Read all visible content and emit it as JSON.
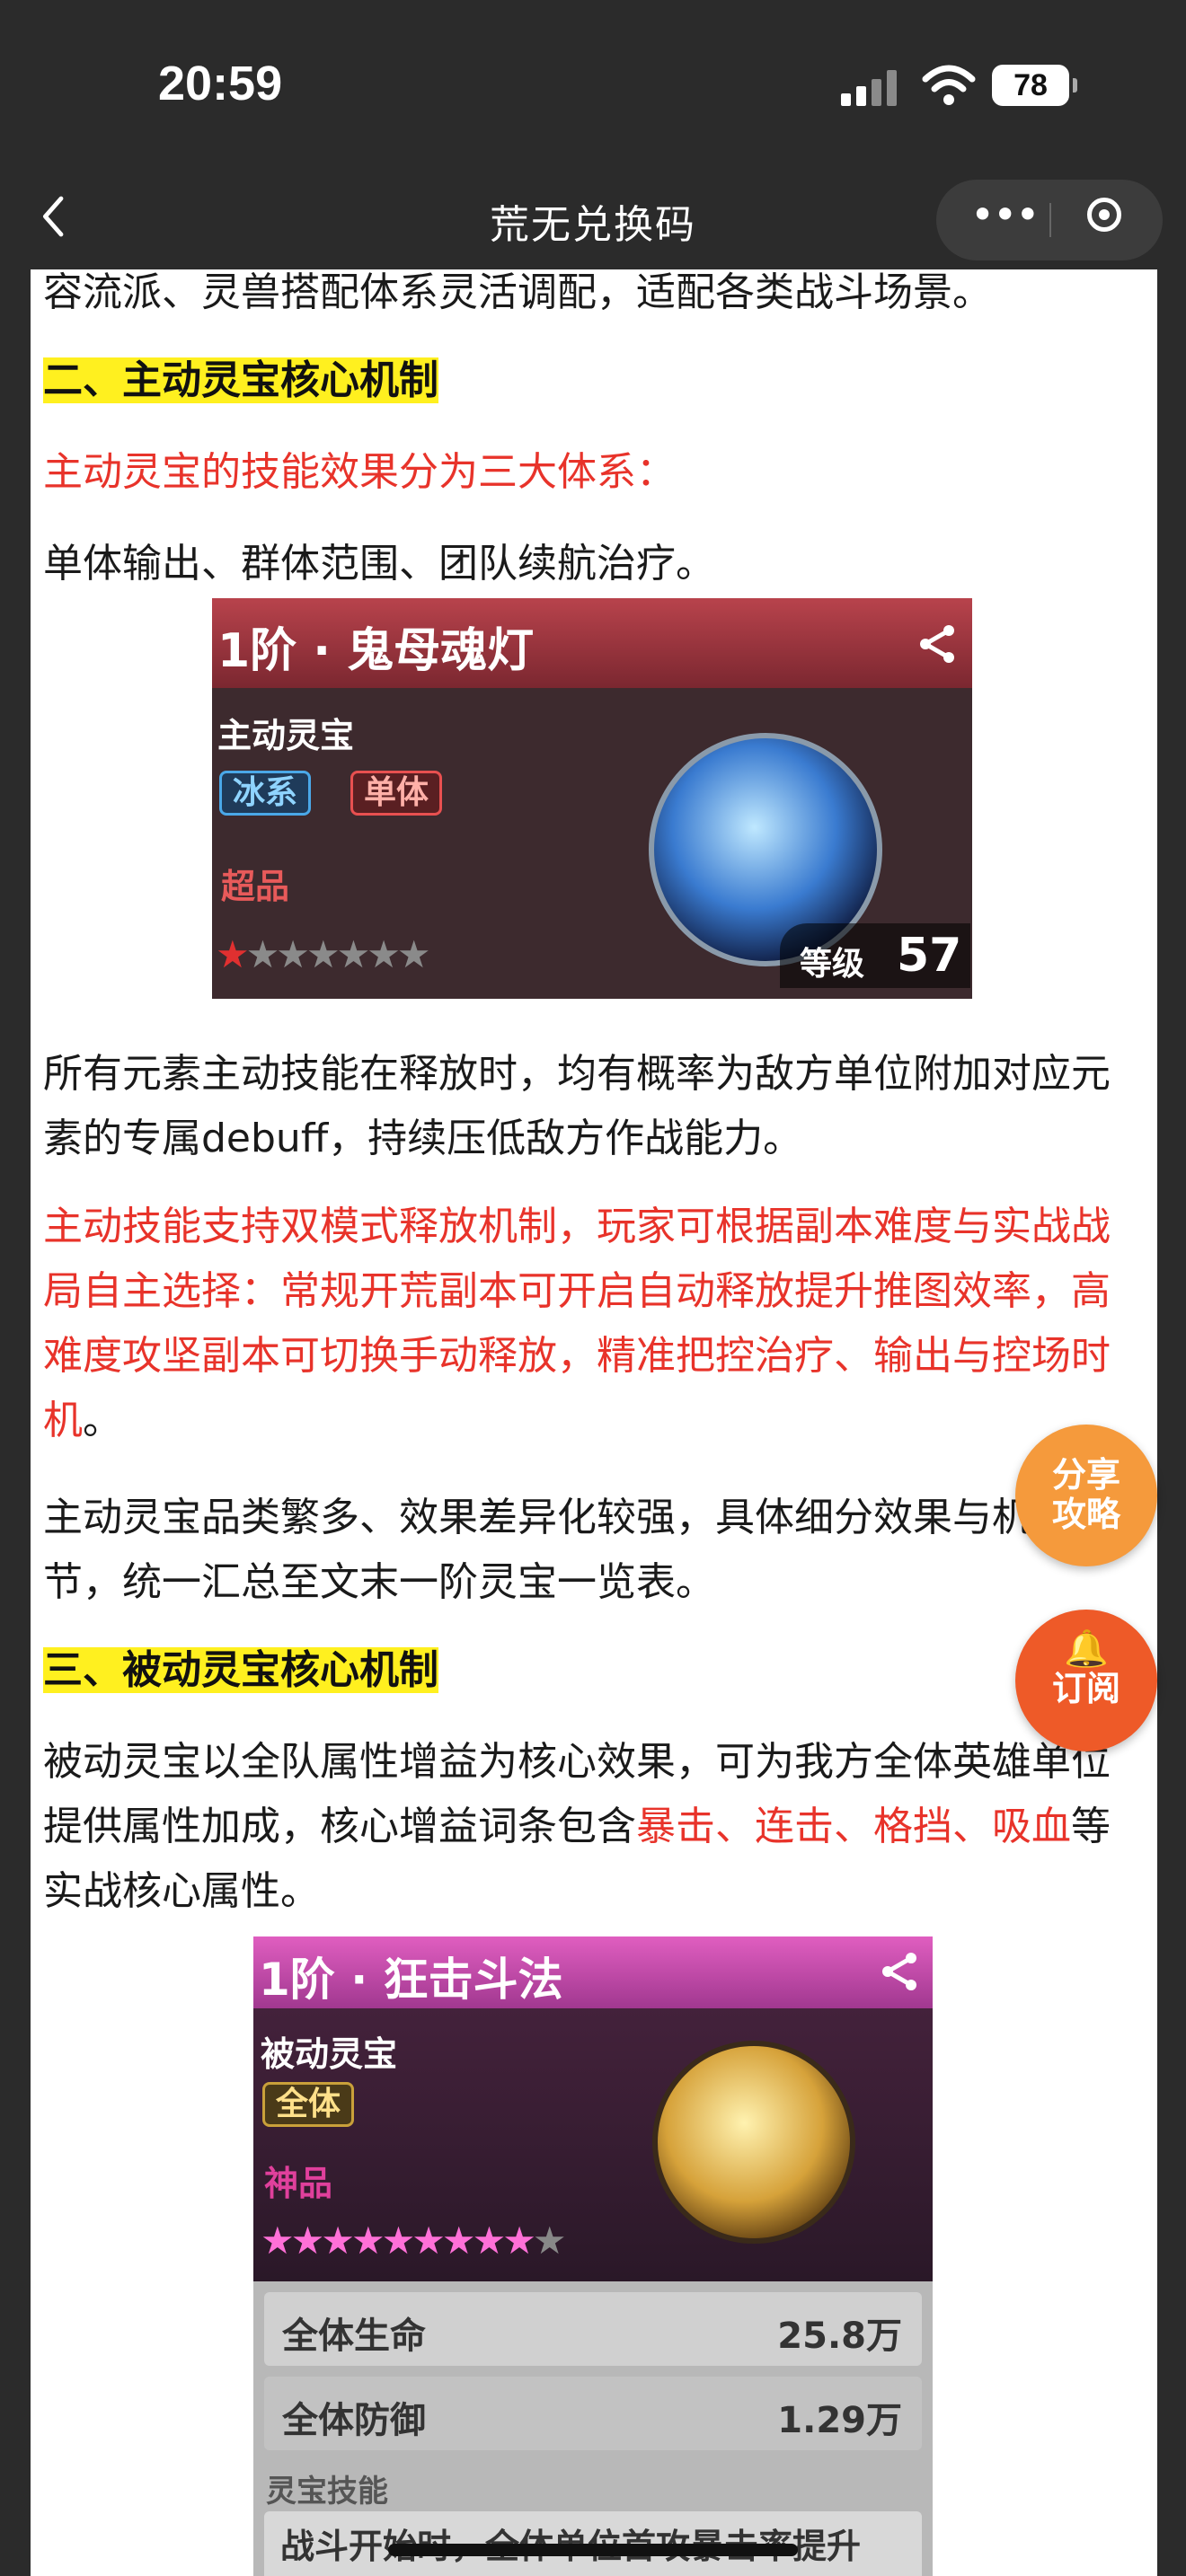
{
  "status": {
    "time": "20:59",
    "battery": "78"
  },
  "nav": {
    "title": "荒无兑换码",
    "back_icon": "chevron-left-icon",
    "more_icon": "more-dots-icon",
    "close_icon": "target-icon"
  },
  "article": {
    "p0": "容流派、灵兽搭配体系灵活调配，适配各类战斗场景。",
    "h2": "二、主动灵宝核心机制",
    "p1": "主动灵宝的技能效果分为三大体系：",
    "p2": "单体输出、群体范围、团队续航治疗。",
    "p3": "所有元素主动技能在释放时，均有概率为敌方单位附加对应元素的专属debuff，持续压低敌方作战能力。",
    "p4_red": "主动技能支持双模式释放机制，玩家可根据副本难度与实战战局自主选择：常规开荒副本可开启自动释放提升推图效率，高难度攻坚副本可切换手动释放，精准把控治疗、输出与控场时机",
    "p4_end": "。",
    "p5": "主动灵宝品类繁多、效果差异化较强，具体细分效果与机制细节，统一汇总至文末一阶灵宝一览表。",
    "h3": "三、被动灵宝核心机制",
    "p6_a": "被动灵宝以全队属性增益为核心效果，可为我方全体英雄单位提供属性加成，核心增益词条包含",
    "p6_red": "暴击、连击、格挡、吸血",
    "p6_b": "等实战核心属性。"
  },
  "card1": {
    "title": "1阶 · 鬼母魂灯",
    "type": "主动灵宝",
    "tags": [
      "冰系",
      "单体"
    ],
    "grade": "超品",
    "stars": "★★★★★★★",
    "level_label": "等级",
    "level": "57"
  },
  "card2": {
    "title": "1阶 · 狂击斗法",
    "type": "被动灵宝",
    "tag": "全体",
    "grade": "神品",
    "stars": "★★★★★★★★★★",
    "stats": [
      {
        "name": "全体生命",
        "value": "25.8万"
      },
      {
        "name": "全体防御",
        "value": "1.29万"
      }
    ],
    "skill_label": "灵宝技能",
    "skill_text": "战斗开始时，全体单位首攻暴击率提升"
  },
  "fab": {
    "share": "分享攻略",
    "subscribe": "订阅",
    "bell_icon": "bell-icon"
  },
  "colors": {
    "accent_red": "#e8332a",
    "highlight": "#fff01f",
    "fab_orange": "#f59a3c",
    "fab_red": "#ee5a28"
  }
}
